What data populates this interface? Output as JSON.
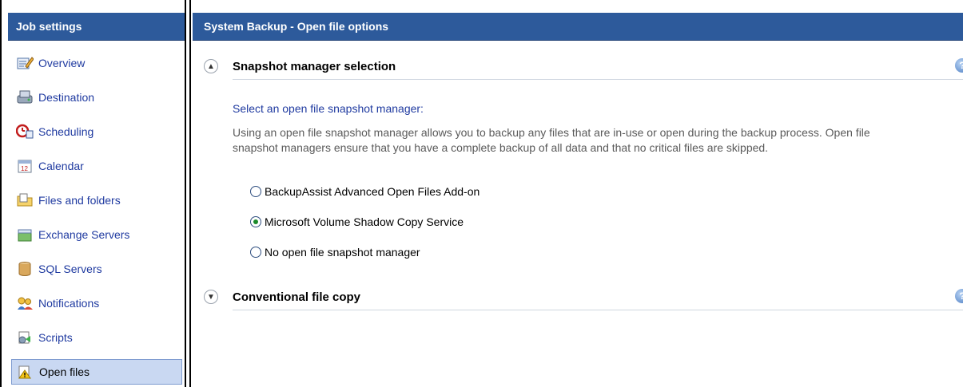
{
  "sidebar": {
    "header": "Job settings",
    "items": [
      {
        "label": "Overview",
        "icon": "overview-icon"
      },
      {
        "label": "Destination",
        "icon": "destination-icon"
      },
      {
        "label": "Scheduling",
        "icon": "scheduling-icon"
      },
      {
        "label": "Calendar",
        "icon": "calendar-icon"
      },
      {
        "label": "Files and folders",
        "icon": "files-folders-icon"
      },
      {
        "label": "Exchange Servers",
        "icon": "exchange-icon"
      },
      {
        "label": "SQL Servers",
        "icon": "database-icon"
      },
      {
        "label": "Notifications",
        "icon": "notifications-icon"
      },
      {
        "label": "Scripts",
        "icon": "scripts-icon"
      },
      {
        "label": "Open files",
        "icon": "open-files-icon",
        "selected": true
      }
    ]
  },
  "main": {
    "header": "System Backup - Open file options",
    "sections": [
      {
        "title": "Snapshot manager selection",
        "expanded": true,
        "prompt": "Select an open file snapshot manager:",
        "description": "Using an open file snapshot manager allows you to backup any files that are in-use or open during the backup process.  Open file snapshot managers ensure that you have a complete backup of all data and that no critical files are skipped.",
        "options": [
          {
            "label": "BackupAssist Advanced Open Files Add-on",
            "checked": false
          },
          {
            "label": "Microsoft Volume Shadow Copy Service",
            "checked": true
          },
          {
            "label": "No open file snapshot manager",
            "checked": false
          }
        ]
      },
      {
        "title": "Conventional file copy",
        "expanded": false
      }
    ]
  }
}
